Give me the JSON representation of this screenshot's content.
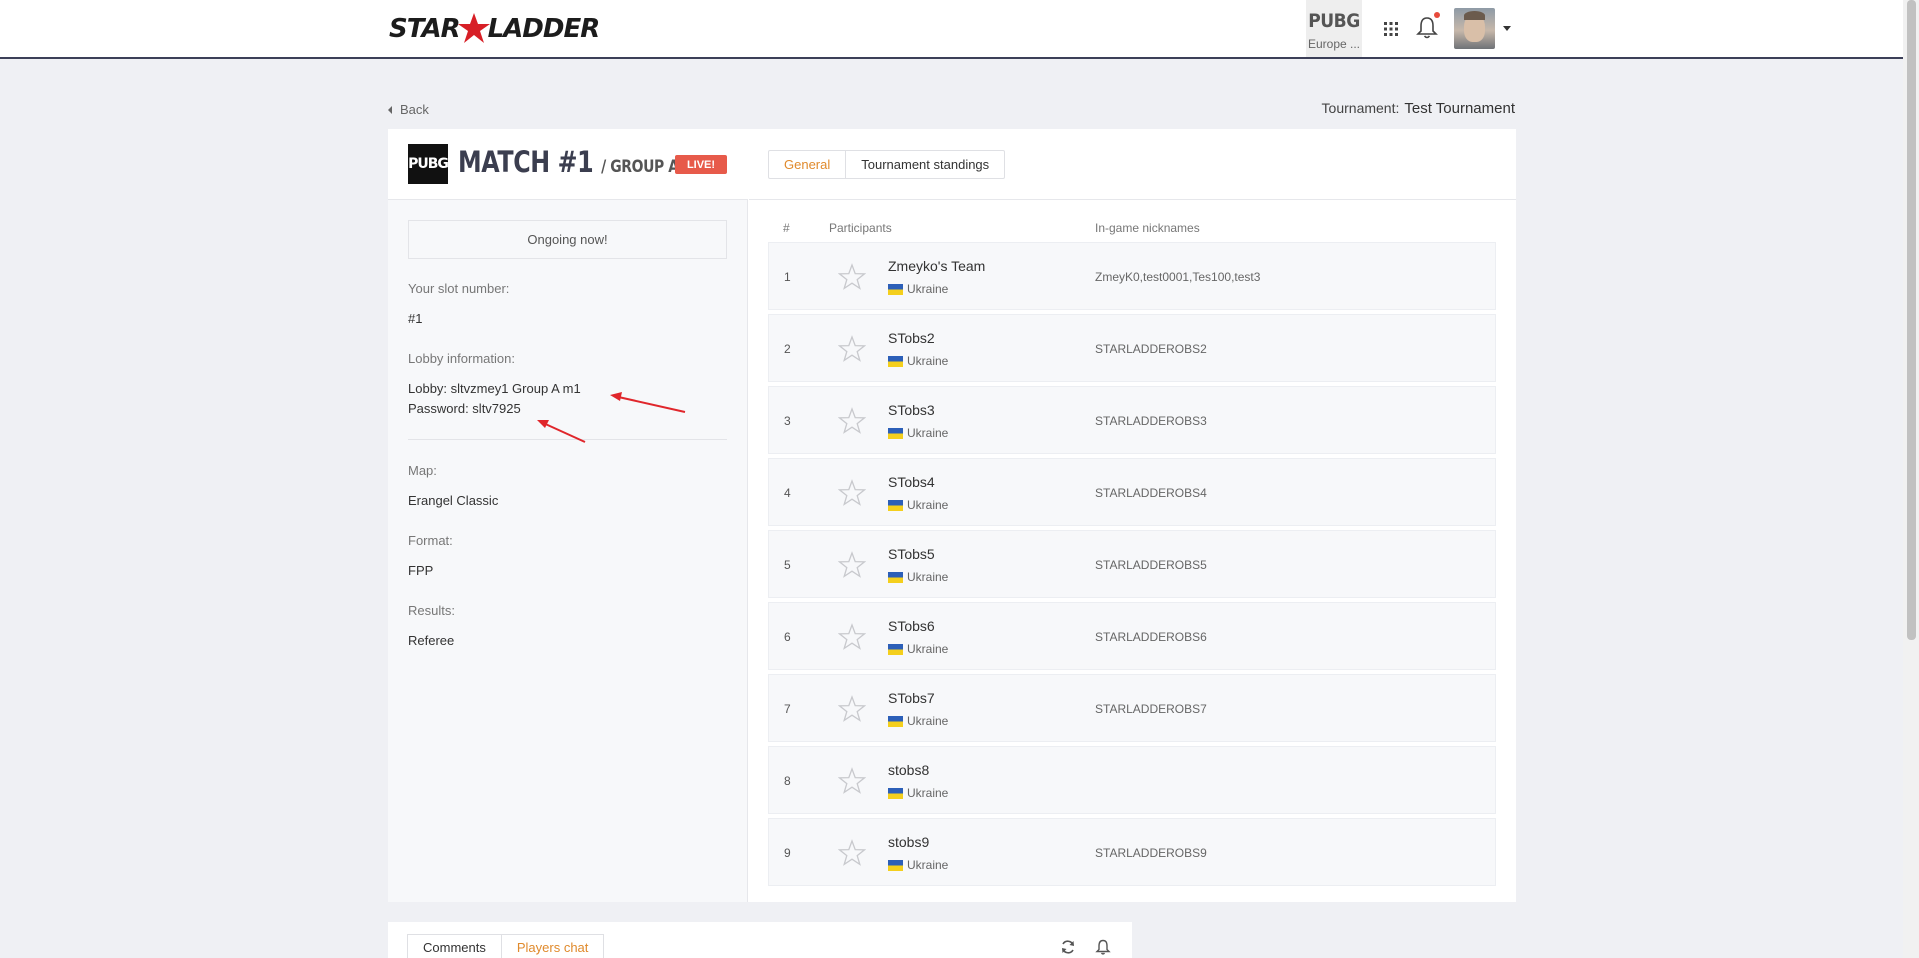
{
  "header": {
    "logo_left": "STAR",
    "logo_right": "LADDER",
    "game": "PUBG",
    "region": "Europe ..."
  },
  "nav": {
    "back": "Back"
  },
  "tournament": {
    "label": "Tournament:",
    "name": "Test Tournament"
  },
  "match": {
    "game_logo": "PUBG",
    "title": "MATCH #1",
    "group": "/ GROUP A",
    "status": "LIVE!"
  },
  "info": {
    "ongoing": "Ongoing now!",
    "slot_label": "Your slot number:",
    "slot_value": "#1",
    "lobby_label": "Lobby information:",
    "lobby_line": "Lobby: sltvzmey1 Group A m1",
    "password_line": "Password: sltv7925",
    "map_label": "Map:",
    "map_value": "Erangel Classic",
    "format_label": "Format:",
    "format_value": "FPP",
    "results_label": "Results:",
    "results_value": "Referee"
  },
  "tabs": [
    "General",
    "Tournament standings"
  ],
  "table": {
    "headers": [
      "#",
      "Participants",
      "In-game nicknames"
    ],
    "rows": [
      {
        "num": "1",
        "team": "Zmeyko's Team",
        "country": "Ukraine",
        "nicks": "ZmeyK0,test0001,Tes100,test3"
      },
      {
        "num": "2",
        "team": "STobs2",
        "country": "Ukraine",
        "nicks": "STARLADDEROBS2"
      },
      {
        "num": "3",
        "team": "STobs3",
        "country": "Ukraine",
        "nicks": "STARLADDEROBS3"
      },
      {
        "num": "4",
        "team": "STobs4",
        "country": "Ukraine",
        "nicks": "STARLADDEROBS4"
      },
      {
        "num": "5",
        "team": "STobs5",
        "country": "Ukraine",
        "nicks": "STARLADDEROBS5"
      },
      {
        "num": "6",
        "team": "STobs6",
        "country": "Ukraine",
        "nicks": "STARLADDEROBS6"
      },
      {
        "num": "7",
        "team": "STobs7",
        "country": "Ukraine",
        "nicks": "STARLADDEROBS7"
      },
      {
        "num": "8",
        "team": "stobs8",
        "country": "Ukraine",
        "nicks": ""
      },
      {
        "num": "9",
        "team": "stobs9",
        "country": "Ukraine",
        "nicks": "STARLADDEROBS9"
      }
    ]
  },
  "bottom_tabs": [
    "Comments",
    "Players chat"
  ],
  "colors": {
    "accent": "#e08a2c",
    "live": "#e75a4a",
    "logo_star": "#d71f26",
    "annotation_arrow": "#e0262b",
    "flag_blue": "#2c5fb8",
    "flag_yellow": "#f4cf1d"
  },
  "icons": [
    "apps-grid-icon",
    "bell-icon",
    "star-icon",
    "refresh-icon",
    "chevron-left-icon",
    "caret-down-icon"
  ]
}
